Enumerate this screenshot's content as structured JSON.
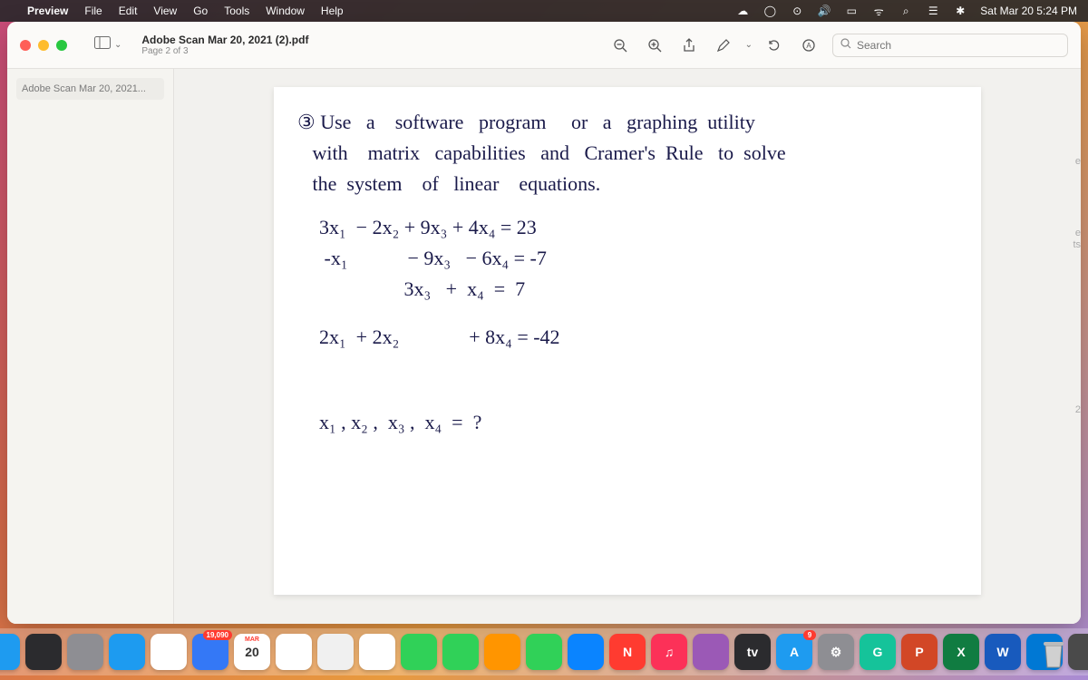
{
  "menubar": {
    "app_name": "Preview",
    "items": [
      "File",
      "Edit",
      "View",
      "Go",
      "Tools",
      "Window",
      "Help"
    ],
    "clock": "Sat Mar 20  5:24 PM"
  },
  "window": {
    "title": "Adobe Scan Mar 20, 2021 (2).pdf",
    "subtitle": "Page 2 of 3",
    "search_placeholder": "Search"
  },
  "sidebar": {
    "items": [
      "Adobe Scan Mar 20, 2021..."
    ]
  },
  "handwriting": {
    "l1": "③ Use   a    software   program     or   a   graphing  utility",
    "l2": "   with    matrix   capabilities   and   Cramer's  Rule   to  solve",
    "l3": "   the  system    of   linear    equations.",
    "l4": "3x₁  − 2x₂ + 9x₃ + 4x₄ = 23",
    "l5": " -x₁            − 9x₃   − 6x₄ = -7",
    "l6": "                 3x₃   +  x₄  =  7",
    "l7": "2x₁  + 2x₂              + 8x₄ = -42",
    "l8": "x₁ , x₂ ,  x₃ ,  x₄  =  ?"
  },
  "edge_hints": {
    "e1": "e",
    "e2": "e",
    "e3": "ts",
    "e4": "2"
  },
  "dock": {
    "items": [
      {
        "name": "finder",
        "color": "#1e9bf0",
        "label": ""
      },
      {
        "name": "siri",
        "color": "#2b2b2e",
        "label": ""
      },
      {
        "name": "launchpad",
        "color": "#8e8e93",
        "label": ""
      },
      {
        "name": "safari",
        "color": "#1d9bf0",
        "label": ""
      },
      {
        "name": "chrome",
        "color": "#ffffff",
        "label": ""
      },
      {
        "name": "mail",
        "color": "#3478f6",
        "label": "",
        "badge": "19,090"
      },
      {
        "name": "calendar",
        "color": "#ffffff",
        "label": "20",
        "badge_top": "MAR"
      },
      {
        "name": "reminders",
        "color": "#ffffff",
        "label": ""
      },
      {
        "name": "freeform",
        "color": "#f0f0f0",
        "label": ""
      },
      {
        "name": "photos",
        "color": "#ffffff",
        "label": ""
      },
      {
        "name": "messages",
        "color": "#30d158",
        "label": ""
      },
      {
        "name": "facetime",
        "color": "#30d158",
        "label": ""
      },
      {
        "name": "pages",
        "color": "#ff9500",
        "label": ""
      },
      {
        "name": "numbers",
        "color": "#30d158",
        "label": ""
      },
      {
        "name": "keynote",
        "color": "#0a84ff",
        "label": ""
      },
      {
        "name": "news",
        "color": "#ff3b30",
        "label": "N"
      },
      {
        "name": "music",
        "color": "#fc3158",
        "label": "♫"
      },
      {
        "name": "podcasts",
        "color": "#9b59b6",
        "label": ""
      },
      {
        "name": "tv",
        "color": "#2b2b2e",
        "label": "tv"
      },
      {
        "name": "appstore",
        "color": "#1e9bf0",
        "label": "A",
        "badge": "9"
      },
      {
        "name": "settings",
        "color": "#8e8e93",
        "label": "⚙"
      },
      {
        "name": "grammarly",
        "color": "#15c39a",
        "label": "G"
      },
      {
        "name": "powerpoint",
        "color": "#d24726",
        "label": "P"
      },
      {
        "name": "excel",
        "color": "#107c41",
        "label": "X"
      },
      {
        "name": "word",
        "color": "#185abd",
        "label": "W"
      },
      {
        "name": "onedrive",
        "color": "#0078d4",
        "label": ""
      },
      {
        "name": "preview",
        "color": "#4a4a4a",
        "label": ""
      }
    ]
  }
}
